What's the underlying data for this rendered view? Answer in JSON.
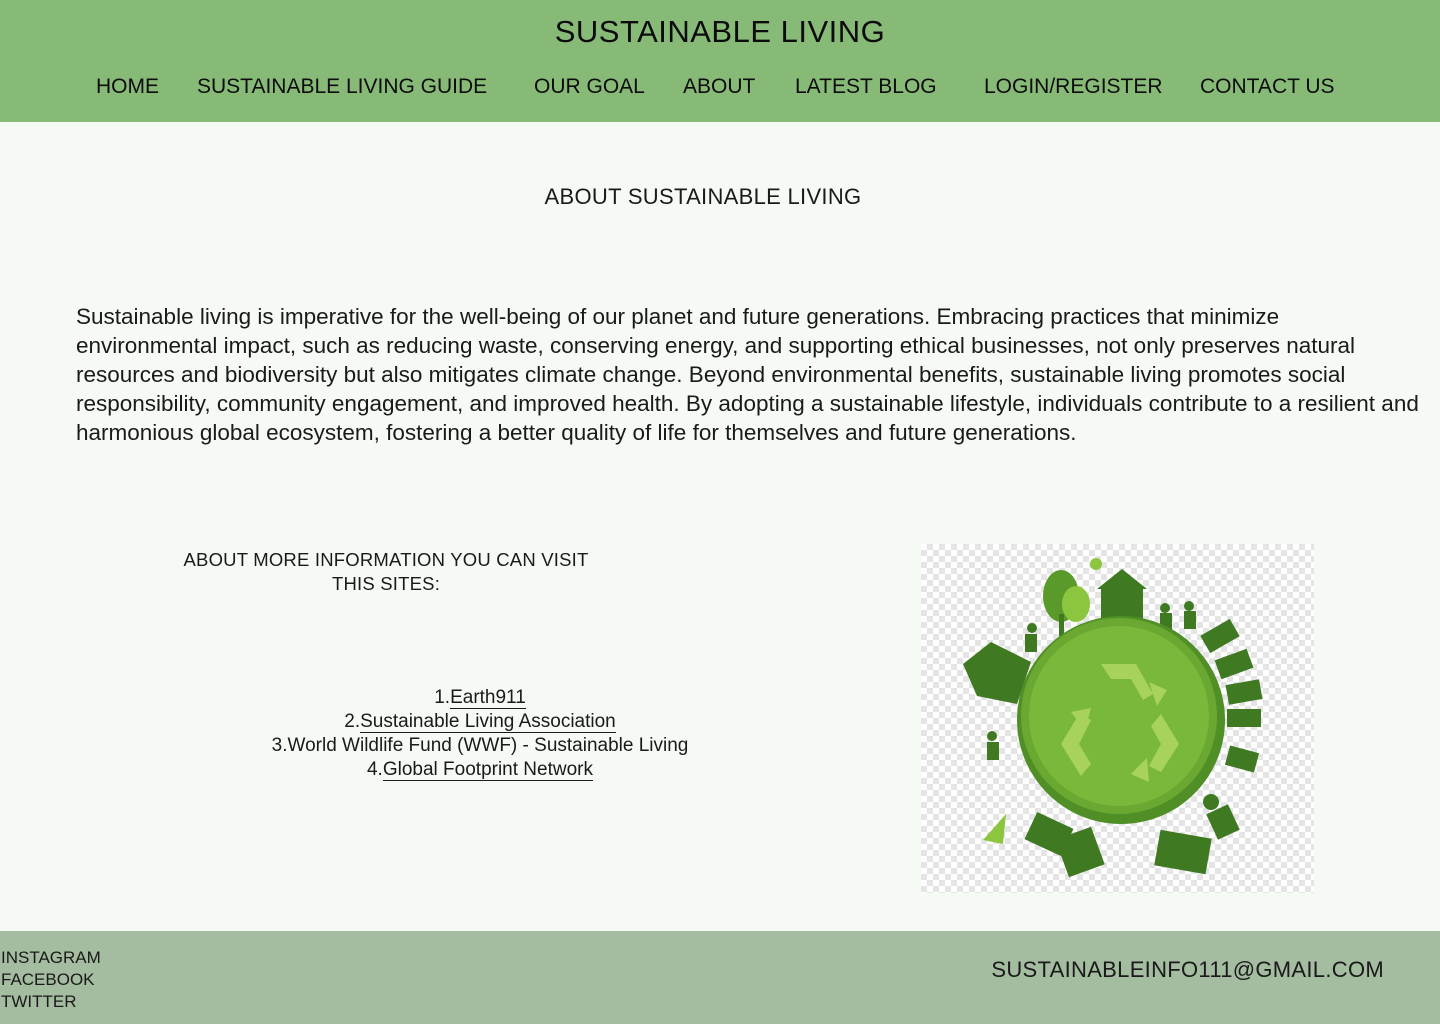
{
  "header": {
    "title": "SUSTAINABLE LIVING",
    "nav": [
      "HOME",
      "SUSTAINABLE LIVING GUIDE",
      "OUR GOAL",
      "ABOUT",
      "LATEST BLOG",
      "LOGIN/REGISTER",
      "CONTACT US"
    ]
  },
  "main": {
    "heading": "ABOUT SUSTAINABLE LIVING",
    "intro": "Sustainable living is imperative for the well-being of our planet and future generations. Embracing practices that minimize environmental impact, such as reducing waste, conserving energy, and supporting ethical businesses, not only preserves natural resources and biodiversity but also mitigates climate change. Beyond environmental benefits, sustainable living promotes social responsibility, community engagement, and improved health. By adopting a sustainable lifestyle, individuals contribute to a resilient and harmonious global ecosystem, fostering a better quality of life for themselves and future generations.",
    "info_heading": "ABOUT MORE INFORMATION YOU CAN VISIT THIS SITES:",
    "links": [
      {
        "number": "1.",
        "label": "Earth911"
      },
      {
        "number": "2.",
        "label": "Sustainable Living Association"
      },
      {
        "number": "3.",
        "label": "World Wildlife Fund (WWF) - Sustainable Living"
      },
      {
        "number": "4.",
        "label": "Global Footprint Network"
      }
    ],
    "image": {
      "icon": "green-earth-recycle-illustration"
    }
  },
  "footer": {
    "social": [
      "INSTAGRAM",
      "FACEBOOK",
      "TWITTER"
    ],
    "email": "SUSTAINABLEINFO111@GMAIL.COM"
  },
  "colors": {
    "header_bg": "#88ba77",
    "page_bg": "#f5faf5",
    "footer_bg": "#a4bca0",
    "earth_green": "#6aa832",
    "dark_green": "#3f7a22"
  }
}
